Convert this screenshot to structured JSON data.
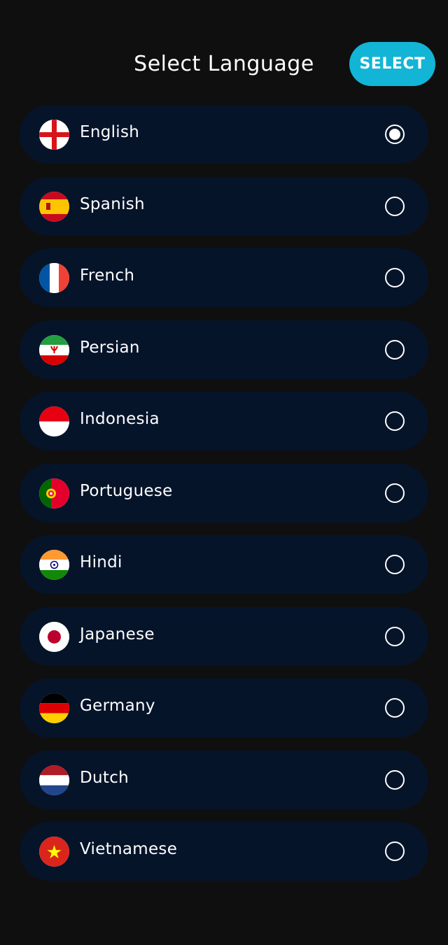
{
  "header": {
    "title": "Select Language",
    "select_label": "SELECT"
  },
  "colors": {
    "background": "#0f0f0f",
    "item_background": "#06142a",
    "accent": "#12b5d6",
    "text": "#ffffff"
  },
  "languages": [
    {
      "label": "English",
      "flag": "england-flag-icon",
      "selected": true
    },
    {
      "label": "Spanish",
      "flag": "spain-flag-icon",
      "selected": false
    },
    {
      "label": "French",
      "flag": "france-flag-icon",
      "selected": false
    },
    {
      "label": "Persian",
      "flag": "iran-flag-icon",
      "selected": false
    },
    {
      "label": "Indonesia",
      "flag": "indonesia-flag-icon",
      "selected": false
    },
    {
      "label": "Portuguese",
      "flag": "portugal-flag-icon",
      "selected": false
    },
    {
      "label": "Hindi",
      "flag": "india-flag-icon",
      "selected": false
    },
    {
      "label": "Japanese",
      "flag": "japan-flag-icon",
      "selected": false
    },
    {
      "label": "Germany",
      "flag": "germany-flag-icon",
      "selected": false
    },
    {
      "label": "Dutch",
      "flag": "netherlands-flag-icon",
      "selected": false
    },
    {
      "label": "Vietnamese",
      "flag": "vietnam-flag-icon",
      "selected": false
    }
  ]
}
